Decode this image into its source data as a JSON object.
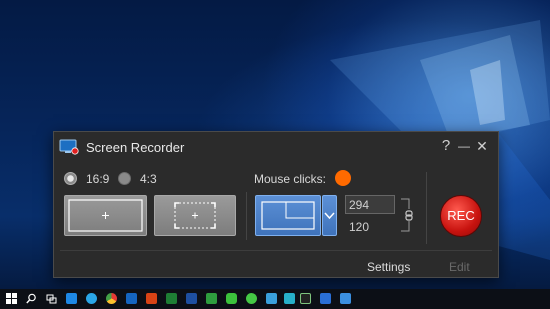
{
  "window": {
    "title": "Screen Recorder",
    "help_label": "?",
    "minimize_label": "—",
    "close_label": "✕"
  },
  "aspect": {
    "option1_label": "16:9",
    "option2_label": "4:3",
    "selected": "16:9"
  },
  "mouse_clicks": {
    "label": "Mouse clicks:",
    "color": "#ff6a00"
  },
  "size": {
    "width_value": "294",
    "height_value": "120",
    "link_icon": "chain-link-icon"
  },
  "rec_label": "REC",
  "footer": {
    "settings_label": "Settings",
    "edit_label": "Edit"
  },
  "taskbar": {
    "icons": [
      "windows-start-icon",
      "search-icon",
      "task-view-icon",
      "edge-icon",
      "ie-icon",
      "chrome-icon",
      "outlook-icon",
      "powerpoint-icon",
      "excel-icon",
      "word-icon",
      "green-app-icon",
      "line-icon",
      "green-circle-icon",
      "video-app-icon",
      "cyan-app-icon",
      "terminal-icon",
      "screen-recorder-icon",
      "app-icon"
    ]
  }
}
